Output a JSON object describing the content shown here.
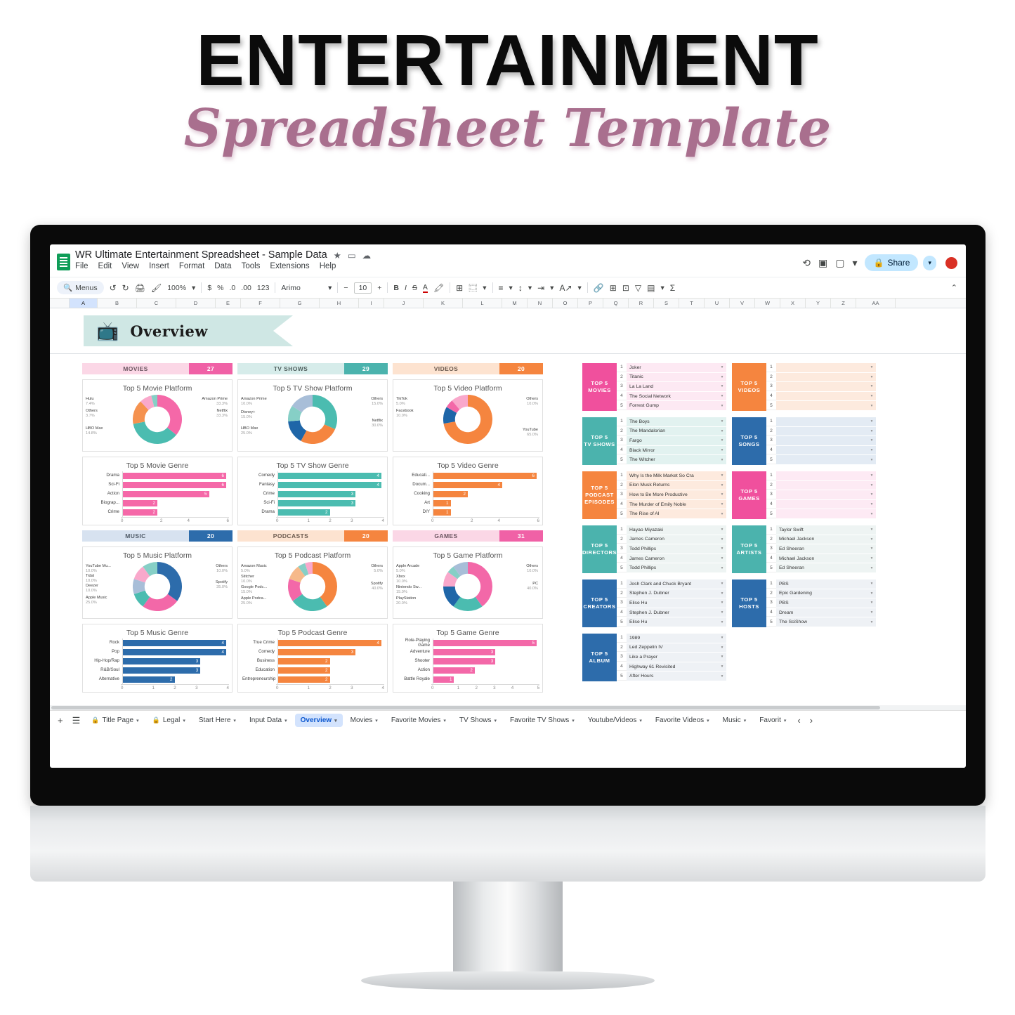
{
  "poster": {
    "title": "ENTERTAINMENT",
    "subtitle": "Spreadsheet Template"
  },
  "app": {
    "doc_title": "WR Ultimate Entertainment Spreadsheet - Sample Data",
    "star_icon": "★",
    "move_icon": "▭",
    "cloud_icon": "☁",
    "menu": [
      "File",
      "Edit",
      "View",
      "Insert",
      "Format",
      "Data",
      "Tools",
      "Extensions",
      "Help"
    ],
    "history_icon": "⟲",
    "comment_icon": "▣",
    "meet_icon": "▢",
    "share_label": "Share",
    "share_lock_icon": "🔒",
    "share_caret": "▾",
    "avatar_name": "user-avatar"
  },
  "toolbar": {
    "search_icon": "🔍",
    "menus_label": "Menus",
    "undo_icon": "↺",
    "redo_icon": "↻",
    "print_icon": "🖨",
    "paint_icon": "🖌",
    "zoom_label": "100%",
    "zoom_caret": "▾",
    "currency_icon": "$",
    "percent_icon": "%",
    "dec_less_icon": ".0",
    "dec_more_icon": ".00",
    "format_123": "123",
    "font_name": "Arimo",
    "font_caret": "▾",
    "minus": "−",
    "font_size": "10",
    "plus": "+",
    "bold": "B",
    "italic": "I",
    "strike": "S",
    "text_color": "A",
    "fill_icon": "🖍",
    "borders_icon": "⊞",
    "merge_icon": "⿴",
    "merge_caret": "▾",
    "halign_icon": "≡",
    "valign_icon": "↕",
    "wrap_icon": "⇥",
    "rotate_icon": "A↗",
    "link_icon": "🔗",
    "comment2_icon": "⊞",
    "chart_icon": "⊡",
    "filter_icon": "▽",
    "filterview_icon": "▤",
    "functions_icon": "Σ",
    "collapse_icon": "⌃"
  },
  "columns": [
    "A",
    "B",
    "C",
    "D",
    "E",
    "F",
    "G",
    "H",
    "I",
    "J",
    "K",
    "L",
    "M",
    "N",
    "O",
    "P",
    "Q",
    "R",
    "S",
    "T",
    "U",
    "V",
    "W",
    "X",
    "Y",
    "Z",
    "AA"
  ],
  "banner": {
    "icon": "📺",
    "label": "Overview"
  },
  "sections": [
    {
      "name": "MOVIES",
      "count": "27",
      "head_bg": "#fbd7e6",
      "count_bg": "#f061a6",
      "name_color": "#6b5560"
    },
    {
      "name": "TV SHOWS",
      "count": "29",
      "head_bg": "#d6ecea",
      "count_bg": "#4bb3ad",
      "name_color": "#50605f"
    },
    {
      "name": "VIDEOS",
      "count": "20",
      "head_bg": "#fde3d0",
      "count_bg": "#f5853f",
      "name_color": "#6b5a4e"
    },
    {
      "name": "MUSIC",
      "count": "20",
      "head_bg": "#d7e2f0",
      "count_bg": "#2d6cab",
      "name_color": "#4f5a66"
    },
    {
      "name": "PODCASTS",
      "count": "20",
      "head_bg": "#fde3d0",
      "count_bg": "#f5853f",
      "name_color": "#6b5a4e"
    },
    {
      "name": "GAMES",
      "count": "31",
      "head_bg": "#fbd7e6",
      "count_bg": "#f061a6",
      "name_color": "#6b5560"
    }
  ],
  "chart_data": [
    {
      "id": "movie-platform",
      "type": "pie",
      "title": "Top 5 Movie Platform",
      "labels": [
        "Amazon Prime",
        "Netflix",
        "HBO Max",
        "Hulu",
        "Others"
      ],
      "values": [
        33.3,
        33.3,
        14.8,
        7.4,
        3.7
      ],
      "value_labels": [
        "33.3%",
        "33.3%",
        "14.8%",
        "7.4%",
        "3.7%"
      ],
      "colors": [
        "#f568a8",
        "#4bbcb0",
        "#f5924f",
        "#f9a8cb",
        "#86cfc6"
      ]
    },
    {
      "id": "tvshow-platform",
      "type": "pie",
      "title": "Top 5 TV Show Platform",
      "labels": [
        "Netflix",
        "HBO Max",
        "Disney+",
        "Amazon Prime",
        "Others"
      ],
      "values": [
        30.0,
        25.0,
        15.0,
        10.0,
        15.0
      ],
      "value_labels": [
        "30.0%",
        "25.0%",
        "15.0%",
        "10.0%",
        "15.0%"
      ],
      "colors": [
        "#4bbcb0",
        "#f5853f",
        "#1f66a8",
        "#86cfc6",
        "#a8bed8"
      ]
    },
    {
      "id": "video-platform",
      "type": "pie",
      "title": "Top 5 Video Platform",
      "labels": [
        "YouTube",
        "Facebook",
        "TikTok",
        "Others"
      ],
      "values": [
        65.0,
        10.0,
        5.0,
        10.0
      ],
      "value_labels": [
        "65.0%",
        "10.0%",
        "5.0%",
        "10.0%"
      ],
      "colors": [
        "#f5853f",
        "#1f66a8",
        "#f368a8",
        "#f9a8cb"
      ],
      "extra_colors": [
        "#5b9bd5",
        "#f9c0da"
      ]
    },
    {
      "id": "music-platform",
      "type": "pie",
      "title": "Top 5 Music Platform",
      "labels": [
        "Spotify",
        "Apple Music",
        "Deezer",
        "Tidal",
        "YouTube Mu...",
        "Others"
      ],
      "values": [
        35.0,
        25.0,
        10.0,
        10.0,
        10.0,
        10.0
      ],
      "value_labels": [
        "35.0%",
        "25.0%",
        "10.0%",
        "10.0%",
        "10.0%",
        "10.0%"
      ],
      "colors": [
        "#2d6cab",
        "#f368a8",
        "#4bbcb0",
        "#a8bed8",
        "#f9a8cb",
        "#86cfc6"
      ]
    },
    {
      "id": "podcast-platform",
      "type": "pie",
      "title": "Top 5 Podcast Platform",
      "labels": [
        "Spotify",
        "Apple Podca...",
        "Google Podc...",
        "Stitcher",
        "Amazon Music",
        "Others"
      ],
      "values": [
        40.0,
        25.0,
        15.0,
        10.0,
        5.0,
        5.0
      ],
      "value_labels": [
        "40.0%",
        "25.0%",
        "15.0%",
        "10.0%",
        "5.0%",
        "5.0%"
      ],
      "colors": [
        "#f5853f",
        "#4bbcb0",
        "#f368a8",
        "#f6b98a",
        "#86cfc6",
        "#f9a8cb"
      ]
    },
    {
      "id": "game-platform",
      "type": "pie",
      "title": "Top 5 Game Platform",
      "labels": [
        "PC",
        "PlayStation",
        "Nintendo Sw...",
        "Xbox",
        "Apple Arcade",
        "Others"
      ],
      "values": [
        40.0,
        20.0,
        15.0,
        10.0,
        5.0,
        10.0
      ],
      "value_labels": [
        "40.0%",
        "20.0%",
        "15.0%",
        "10.0%",
        "5.0%",
        "10.0%"
      ],
      "colors": [
        "#f368a8",
        "#4bbcb0",
        "#1f66a8",
        "#f9a8cb",
        "#86cfc6",
        "#a8bed8"
      ]
    },
    {
      "id": "movie-genre",
      "type": "bar",
      "title": "Top 5 Movie Genre",
      "categories": [
        "Drama",
        "Sci-Fi",
        "Action",
        "Biograp...",
        "Crime"
      ],
      "values": [
        6,
        6,
        5,
        2,
        2
      ],
      "ticks": [
        "0",
        "2",
        "4",
        "6"
      ],
      "xmax": 6,
      "color": "#f568a8",
      "xlabel": "",
      "ylabel": ""
    },
    {
      "id": "tvshow-genre",
      "type": "bar",
      "title": "Top 5 TV Show Genre",
      "categories": [
        "Comedy",
        "Fantasy",
        "Crime",
        "Sci-Fi",
        "Drama"
      ],
      "values": [
        4,
        4,
        3,
        3,
        2
      ],
      "ticks": [
        "0",
        "1",
        "2",
        "3",
        "4"
      ],
      "xmax": 4,
      "color": "#4bbcb0",
      "xlabel": "",
      "ylabel": ""
    },
    {
      "id": "video-genre",
      "type": "bar",
      "title": "Top 5 Video Genre",
      "categories": [
        "Educati...",
        "Docum...",
        "Cooking",
        "Art",
        "DIY"
      ],
      "values": [
        6,
        4,
        2,
        1,
        1
      ],
      "ticks": [
        "0",
        "2",
        "4",
        "6"
      ],
      "xmax": 6,
      "color": "#f5853f",
      "xlabel": "",
      "ylabel": ""
    },
    {
      "id": "music-genre",
      "type": "bar",
      "title": "Top 5 Music Genre",
      "categories": [
        "Rock",
        "Pop",
        "Hip-Hop/Rap",
        "R&B/Soul",
        "Alternative"
      ],
      "values": [
        4,
        4,
        3,
        3,
        2
      ],
      "ticks": [
        "0",
        "1",
        "2",
        "3",
        "4"
      ],
      "xmax": 4,
      "color": "#2d6cab",
      "xlabel": "",
      "ylabel": ""
    },
    {
      "id": "podcast-genre",
      "type": "bar",
      "title": "Top 5 Podcast Genre",
      "categories": [
        "True Crime",
        "Comedy",
        "Business",
        "Education",
        "Entrepreneurship"
      ],
      "values": [
        4,
        3,
        2,
        2,
        2
      ],
      "ticks": [
        "0",
        "1",
        "2",
        "3",
        "4"
      ],
      "xmax": 4,
      "color": "#f5853f",
      "xlabel": "",
      "ylabel": ""
    },
    {
      "id": "game-genre",
      "type": "bar",
      "title": "Top 5 Game Genre",
      "categories": [
        "Role-Playing Game",
        "Adventure",
        "Shooter",
        "Action",
        "Battle Royale"
      ],
      "values": [
        5,
        3,
        3,
        2,
        1
      ],
      "ticks": [
        "0",
        "1",
        "2",
        "3",
        "4",
        "5"
      ],
      "xmax": 5,
      "color": "#f368a8",
      "xlabel": "",
      "ylabel": ""
    }
  ],
  "top5_lists": [
    {
      "id": "top5-movies",
      "badge": "TOP 5 MOVIES",
      "badge_bg": "#f0509d",
      "row_bg": "#fde9f3",
      "items": [
        "Joker",
        "Titanic",
        "La La Land",
        "The Social Network",
        "Forrest Gump"
      ]
    },
    {
      "id": "top5-videos",
      "badge": "TOP 5 VIDEOS",
      "badge_bg": "#f5853f",
      "row_bg": "#fdeade",
      "items": [
        "",
        "",
        "",
        "",
        ""
      ]
    },
    {
      "id": "top5-tvshows",
      "badge": "TOP 5 TV SHOWS",
      "badge_bg": "#4bb3ad",
      "row_bg": "#e2f2f0",
      "items": [
        "The Boys",
        "The Mandalorian",
        "Fargo",
        "Black Mirror",
        "The Witcher"
      ]
    },
    {
      "id": "top5-songs",
      "badge": "TOP 5 SONGS",
      "badge_bg": "#2d6cab",
      "row_bg": "#e3ebf4",
      "items": [
        "",
        "",
        "",
        "",
        ""
      ]
    },
    {
      "id": "top5-podcast-episodes",
      "badge": "TOP 5 PODCAST EPISODES",
      "badge_bg": "#f5853f",
      "row_bg": "#fdeade",
      "items": [
        "Why Is the Milk Market So Cra",
        "Elon Musk Returns",
        "How to Be More Productive",
        "The Murder of Emily Noble",
        "The Rise of AI"
      ]
    },
    {
      "id": "top5-games",
      "badge": "TOP 5 GAMES",
      "badge_bg": "#f0509d",
      "row_bg": "#fdeaf4",
      "items": [
        "",
        "",
        "",
        "",
        ""
      ]
    },
    {
      "id": "top5-directors",
      "badge": "TOP 5 DIRECTORS",
      "badge_bg": "#4bb3ad",
      "row_bg": "#eef4f3",
      "items": [
        "Hayao Miyazaki",
        "James Cameron",
        "Todd Phillips",
        "James Cameron",
        "Todd Phillips"
      ]
    },
    {
      "id": "top5-artists",
      "badge": "TOP 5 ARTISTS",
      "badge_bg": "#4bb3ad",
      "row_bg": "#eef4f3",
      "items": [
        "Taylor Swift",
        "Michael Jackson",
        "Ed Sheeran",
        "Michael Jackson",
        "Ed Sheeran"
      ]
    },
    {
      "id": "top5-creators",
      "badge": "TOP 5 CREATORS",
      "badge_bg": "#2d6cab",
      "row_bg": "#eef1f5",
      "items": [
        "Josh Clark and Chuck Bryant",
        "Stephen J. Dubner",
        "Elise Hu",
        "Stephen J. Dubner",
        "Elise Hu"
      ]
    },
    {
      "id": "top5-hosts",
      "badge": "TOP 5 HOSTS",
      "badge_bg": "#2d6cab",
      "row_bg": "#eef1f5",
      "items": [
        "PBS",
        "Epic Gardening",
        "PBS",
        "Dream",
        "The SciShow"
      ]
    },
    {
      "id": "top5-album",
      "badge": "TOP 5 ALBUM",
      "badge_bg": "#2d6cab",
      "row_bg": "#eef1f5",
      "items": [
        "1989",
        "Led Zeppelin IV",
        "Like a Prayer",
        "Highway 61 Revisited",
        "After Hours"
      ]
    }
  ],
  "tabs": {
    "add_icon": "+",
    "all_sheets_icon": "☰",
    "items": [
      {
        "label": "Title Page",
        "locked": true,
        "active": false
      },
      {
        "label": "Legal",
        "locked": true,
        "active": false
      },
      {
        "label": "Start Here",
        "locked": false,
        "active": false
      },
      {
        "label": "Input Data",
        "locked": false,
        "active": false
      },
      {
        "label": "Overview",
        "locked": false,
        "active": true
      },
      {
        "label": "Movies",
        "locked": false,
        "active": false
      },
      {
        "label": "Favorite Movies",
        "locked": false,
        "active": false
      },
      {
        "label": "TV Shows",
        "locked": false,
        "active": false
      },
      {
        "label": "Favorite TV Shows",
        "locked": false,
        "active": false
      },
      {
        "label": "Youtube/Videos",
        "locked": false,
        "active": false
      },
      {
        "label": "Favorite Videos",
        "locked": false,
        "active": false
      },
      {
        "label": "Music",
        "locked": false,
        "active": false
      },
      {
        "label": "Favorit",
        "locked": false,
        "active": false
      }
    ],
    "prev_icon": "‹",
    "next_icon": "›",
    "lock_icon": "🔒",
    "caret_icon": "▾"
  }
}
